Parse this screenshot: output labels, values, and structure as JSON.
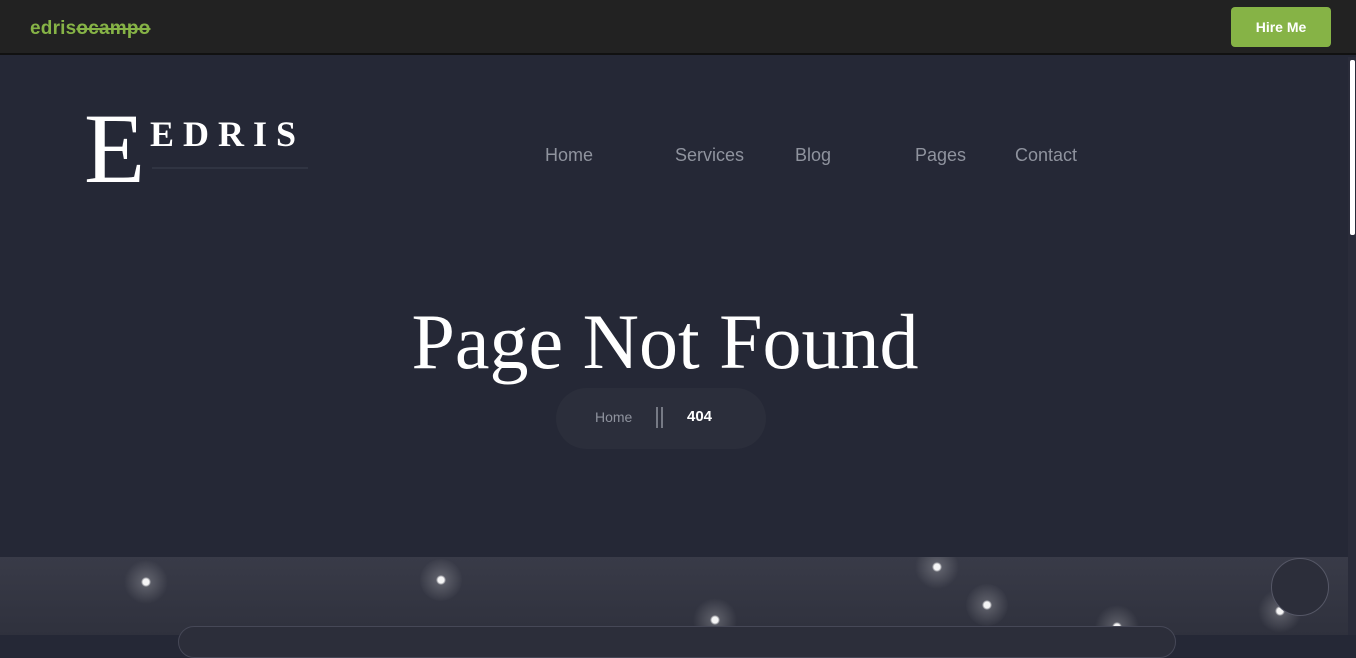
{
  "topbar": {
    "brand_part1": "edris",
    "brand_part2": "ocampo",
    "hire_label": "Hire Me"
  },
  "logo": {
    "letter": "E",
    "text": "EDRIS"
  },
  "nav": {
    "items": [
      {
        "label": "Home"
      },
      {
        "label": "Services"
      },
      {
        "label": "Blog"
      },
      {
        "label": "Pages"
      },
      {
        "label": "Contact"
      }
    ]
  },
  "hero": {
    "title": "Page Not Found"
  },
  "breadcrumb": {
    "home_label": "Home",
    "current_label": "404"
  },
  "colors": {
    "accent": "#86b346",
    "background": "#252836",
    "topbar": "#222222",
    "nav_text": "#8f939e"
  }
}
